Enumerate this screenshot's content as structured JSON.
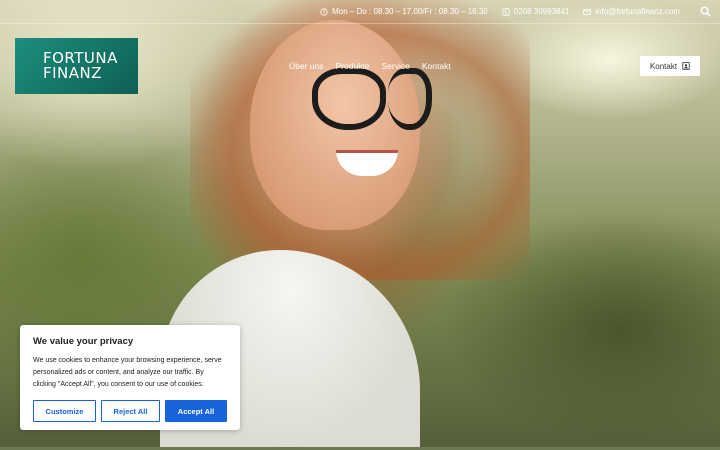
{
  "topbar": {
    "hours": "Mon – Do : 08.30 – 17.00/Fr : 08.30 – 16.30",
    "phone": "0208 30993841",
    "email": "info@fortunafinanz.com"
  },
  "logo": {
    "line1": "FORTUNA",
    "line2": "FINANZ"
  },
  "nav": {
    "items": [
      "Über uns",
      "Produkte",
      "Service",
      "Kontakt"
    ]
  },
  "cta": {
    "label": "Kontakt"
  },
  "cookie_banner": {
    "title": "We value your privacy",
    "text": "We use cookies to enhance your browsing experience, serve personalized ads or content, and analyze our traffic. By clicking \"Accept All\", you consent to our use of cookies.",
    "customize_label": "Customize",
    "reject_label": "Reject All",
    "accept_label": "Accept All"
  },
  "colors": {
    "brand_green": "#157466",
    "cookie_accent": "#1863dc"
  }
}
